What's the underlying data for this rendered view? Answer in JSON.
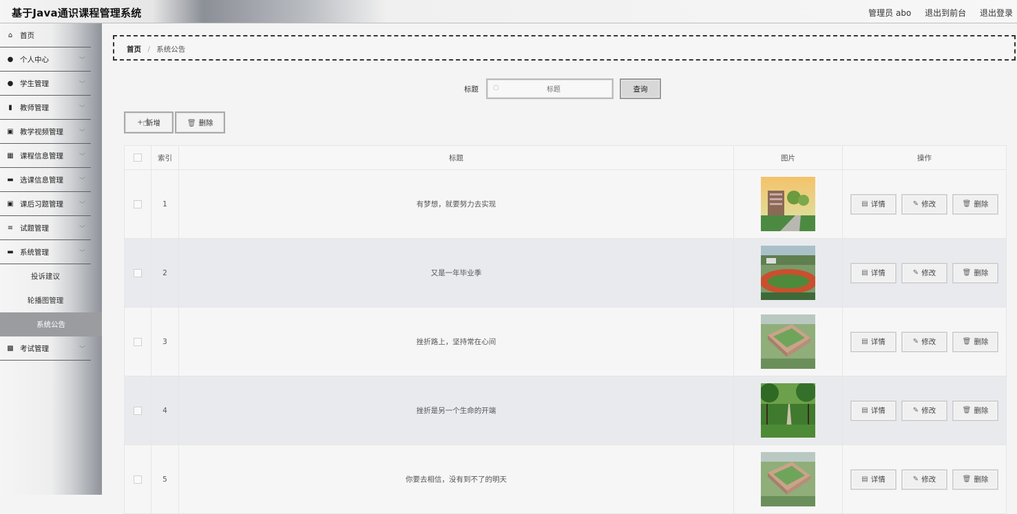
{
  "header": {
    "title": "基于Java通识课程管理系统",
    "user_label": "管理员 abo",
    "front_label": "退出到前台",
    "logout_label": "退出登录"
  },
  "sidebar": {
    "items": [
      {
        "label": "首页",
        "icon": "home-icon",
        "glyph": "⌂",
        "chevron": false
      },
      {
        "label": "个人中心",
        "icon": "user-icon",
        "glyph": "●",
        "chevron": true
      },
      {
        "label": "学生管理",
        "icon": "pin-icon",
        "glyph": "●",
        "chevron": true
      },
      {
        "label": "教师管理",
        "icon": "bar-chart-icon",
        "glyph": "▮",
        "chevron": true
      },
      {
        "label": "教学视频管理",
        "icon": "clipboard-icon",
        "glyph": "▣",
        "chevron": true
      },
      {
        "label": "课程信息管理",
        "icon": "grid-icon",
        "glyph": "▦",
        "chevron": true
      },
      {
        "label": "选课信息管理",
        "icon": "chat-icon",
        "glyph": "▬",
        "chevron": true
      },
      {
        "label": "课后习题管理",
        "icon": "checklist-icon",
        "glyph": "▣",
        "chevron": true
      },
      {
        "label": "试题管理",
        "icon": "sliders-icon",
        "glyph": "≡",
        "chevron": true
      },
      {
        "label": "系统管理",
        "icon": "briefcase-icon",
        "glyph": "▬",
        "chevron": true
      }
    ],
    "sub_items": [
      {
        "label": "投诉建议",
        "active": false
      },
      {
        "label": "轮播图管理",
        "active": false
      },
      {
        "label": "系统公告",
        "active": true
      }
    ],
    "last_item": {
      "label": "考试管理",
      "icon": "chart-box-icon",
      "glyph": "▩",
      "chevron": true
    }
  },
  "breadcrumb": {
    "home": "首页",
    "separator": "/",
    "current": "系统公告"
  },
  "search": {
    "label": "标题",
    "placeholder": "标题",
    "button": "查询"
  },
  "toolbar": {
    "add_label": "新增",
    "delete_label": "删除"
  },
  "table": {
    "headers": {
      "index": "索引",
      "title": "标题",
      "image": "图片",
      "ops": "操作"
    },
    "ops": {
      "detail": "详情",
      "edit": "修改",
      "delete": "删除"
    },
    "rows": [
      {
        "index": "1",
        "title": "有梦想，就要努力去实现",
        "image": "campus-building-road"
      },
      {
        "index": "2",
        "title": "又是一年毕业季",
        "image": "running-track"
      },
      {
        "index": "3",
        "title": "挫折路上，坚持常在心间",
        "image": "campus-aerial"
      },
      {
        "index": "4",
        "title": "挫折是另一个生命的开端",
        "image": "tree-lined-path"
      },
      {
        "index": "5",
        "title": "你要去相信，没有到不了的明天",
        "image": "campus-aerial"
      }
    ]
  },
  "colors": {
    "sidebar_active": "#9a9ca0",
    "row_alt": "#e9eaee"
  }
}
